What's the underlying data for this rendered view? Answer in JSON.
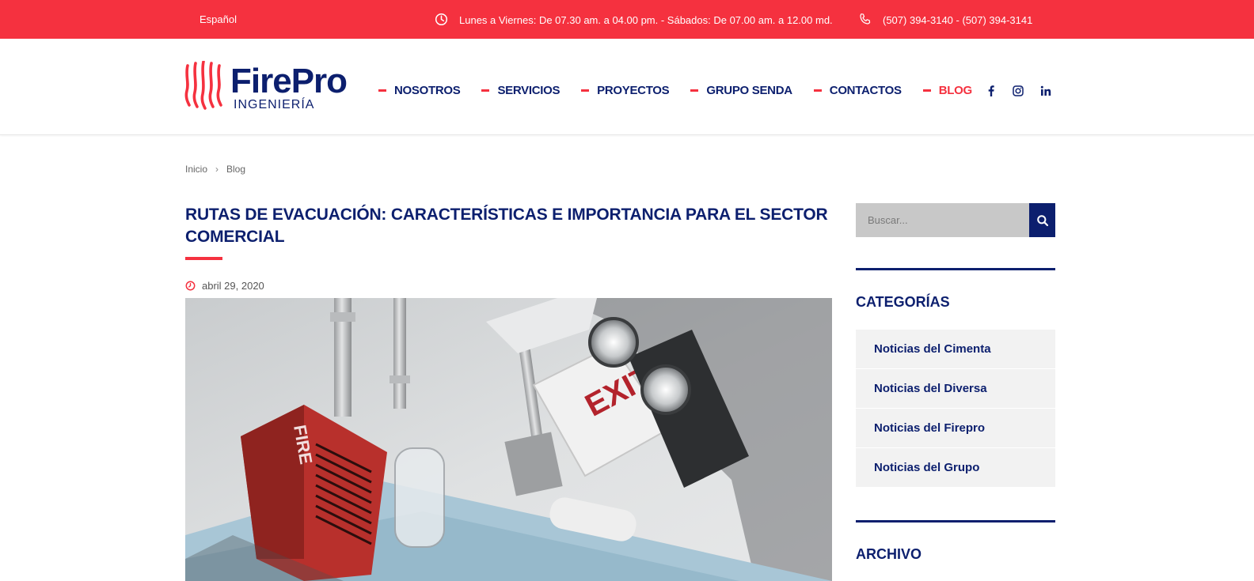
{
  "topbar": {
    "language": "Español",
    "hours": "Lunes a Viernes: De 07.30 am. a 04.00 pm. - Sábados: De 07.00 am. a 12.00 md.",
    "phones": "(507) 394-3140 - (507) 394-3141"
  },
  "logo": {
    "brand": "FirePro",
    "sub": "INGENIERÍA"
  },
  "nav": {
    "items": [
      {
        "label": "NOSOTROS"
      },
      {
        "label": "SERVICIOS"
      },
      {
        "label": "PROYECTOS"
      },
      {
        "label": "GRUPO SENDA"
      },
      {
        "label": "CONTACTOS"
      },
      {
        "label": "BLOG",
        "active": true
      }
    ]
  },
  "social": [
    "facebook-icon",
    "instagram-icon",
    "linkedin-icon"
  ],
  "breadcrumb": {
    "home": "Inicio",
    "current": "Blog"
  },
  "article": {
    "title": "RUTAS DE EVACUACIÓN: CARACTERÍSTICAS E IMPORTANCIA PARA EL SECTOR COMERCIAL",
    "date": "abril 29, 2020",
    "image_text": {
      "sign": "EXIT",
      "alarm": "FIRE"
    }
  },
  "sidebar": {
    "search_placeholder": "Buscar...",
    "categories_title": "CATEGORÍAS",
    "categories": [
      "Noticias del Cimenta",
      "Noticias del Diversa",
      "Noticias del Firepro",
      "Noticias del Grupo"
    ],
    "archive_title": "ARCHIVO"
  },
  "colors": {
    "accent": "#f5313f",
    "brand": "#0c1f6e"
  }
}
